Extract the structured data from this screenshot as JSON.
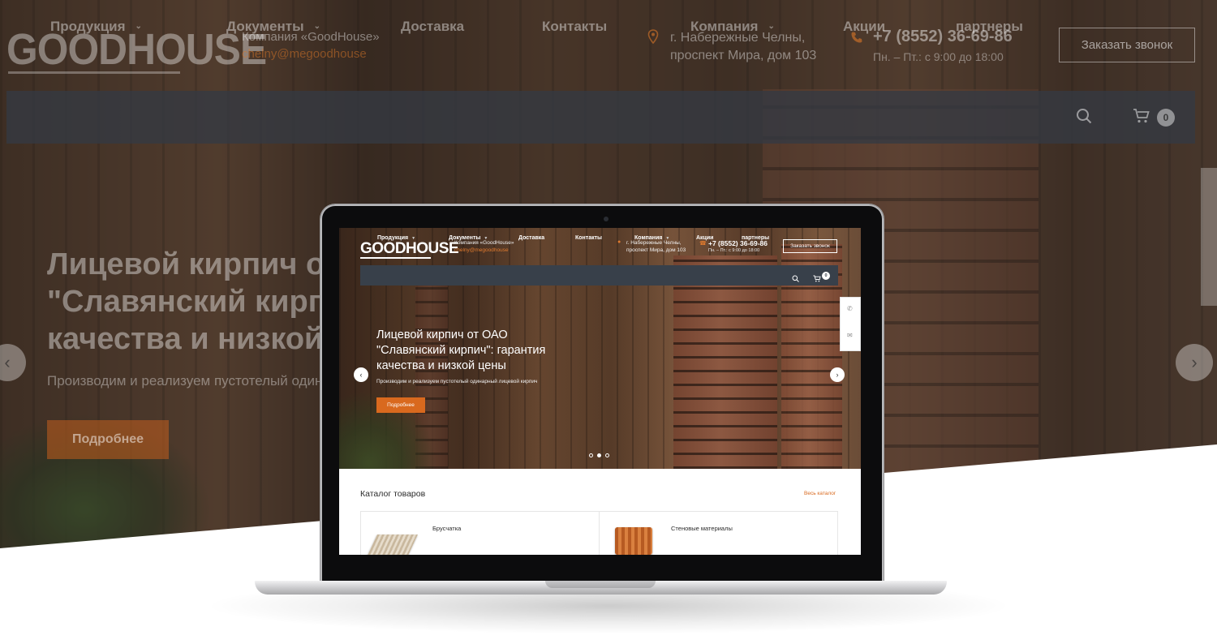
{
  "site": {
    "logo_text": "GOODHOUSE",
    "company": "Компания «GoodHouse»",
    "email": "chelny@megoodhouse",
    "address_line1": "г. Набережные Челны,",
    "address_line2": "проспект Мира, дом 103",
    "phone": "+7 (8552) 36-69-86",
    "hours": "Пн. – Пт.: с 9:00 до 18:00",
    "call_button": "Заказать звонок",
    "cart_count": "0",
    "nav": [
      {
        "label": "Продукция",
        "dropdown": true
      },
      {
        "label": "Документы",
        "dropdown": true
      },
      {
        "label": "Доставка",
        "dropdown": false
      },
      {
        "label": "Контакты",
        "dropdown": false
      },
      {
        "label": "Компания",
        "dropdown": true
      },
      {
        "label": "Акции",
        "dropdown": false
      },
      {
        "label": "партнеры",
        "dropdown": false
      }
    ],
    "hero": {
      "title_bg": "Лицевой кирпич от ОАО \"Славянский кирпич\": гарантия качества и низкой цены",
      "title_line1": "Лицевой кирпич от ОАО",
      "title_line2": "\"Славянский кирпич\": гарантия",
      "title_line3": "качества и низкой цены",
      "subtitle": "Производим и реализуем пустотелый одинарный лицевой кирпич",
      "button": "Подробнее",
      "slides_total": 3,
      "active_slide": 2
    },
    "catalog": {
      "title": "Каталог товаров",
      "all_link": "Весь каталог",
      "items": [
        {
          "label": "Брусчатка"
        },
        {
          "label": "Стеновые материалы"
        }
      ]
    }
  },
  "colors": {
    "accent": "#d9691e",
    "nav_bg": "#38404a"
  },
  "icons": {
    "search": "search-icon",
    "cart": "cart-icon",
    "phone": "phone-icon",
    "location": "location-pin-icon",
    "arrow_left": "chevron-left-icon",
    "arrow_right": "chevron-right-icon",
    "mail": "mail-icon"
  }
}
